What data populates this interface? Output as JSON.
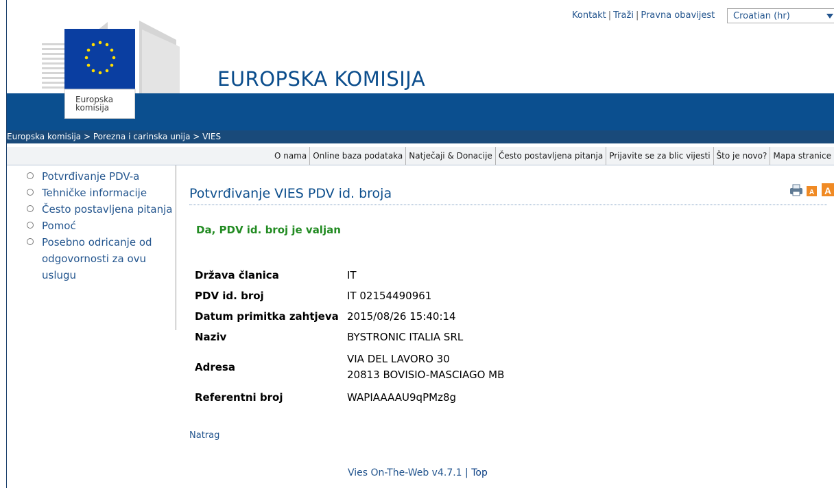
{
  "top_links": [
    "Kontakt",
    "Traži",
    "Pravna obavijest"
  ],
  "language": {
    "selected": "Croatian (hr)"
  },
  "logo": {
    "text_line1": "Europska",
    "text_line2": "komisija"
  },
  "site_title": "EUROPSKA KOMISIJA",
  "breadcrumb": "Europska komisija > Porezna i carinska unija > VIES",
  "top_nav": [
    "O nama",
    "Online baza podataka",
    "Natječaji & Donacije",
    "Često postavljena pitanja",
    "Prijavite se za blic vijesti",
    "Što je novo?",
    "Mapa stranice"
  ],
  "sidebar": [
    "Potvrđivanje PDV-a",
    "Tehničke informacije",
    "Često postavljena pitanja",
    "Pomoć",
    "Posebno odricanje od odgovornosti za ovu uslugu"
  ],
  "page_heading": "Potvrđivanje VIES PDV id. broja",
  "status_message": "Da, PDV id. broj je valjan",
  "results": {
    "member_state": {
      "label": "Država članica",
      "value": "IT"
    },
    "vat_number": {
      "label": "PDV id. broj",
      "value": "IT 02154490961"
    },
    "request_date": {
      "label": "Datum primitka zahtjeva",
      "value": "2015/08/26 15:40:14"
    },
    "name": {
      "label": "Naziv",
      "value": "BYSTRONIC ITALIA SRL"
    },
    "address": {
      "label": "Adresa",
      "line1": "VIA DEL LAVORO 30",
      "line2": "20813 BOVISIO-MASCIAGO MB"
    },
    "reference": {
      "label": "Referentni broj",
      "value": "WAPIAAAAU9qPMz8g"
    }
  },
  "back_link": "Natrag",
  "footer": {
    "version": "Vies On-The-Web v4.7.1",
    "top": "Top"
  },
  "colors": {
    "eu_blue": "#0b4f8f",
    "link": "#23558e",
    "valid_green": "#228b22"
  }
}
